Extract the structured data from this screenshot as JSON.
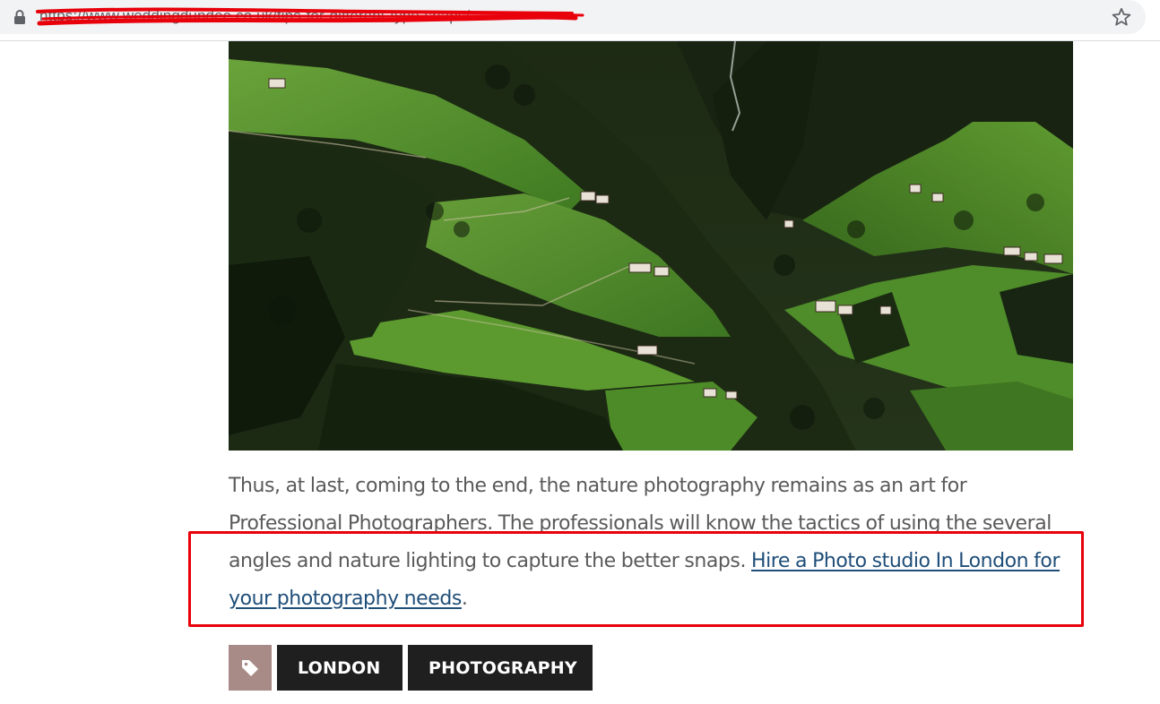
{
  "browser": {
    "url": "https://www.weddingdundee.co.uk/tips-for-different-type-snaps/",
    "bookmark_icon": "star-icon",
    "lock_icon": "lock-icon",
    "redaction_color": "#e8000b"
  },
  "article": {
    "image_alt": "Mountain valley with green meadows, forests and farmhouses",
    "paragraph_text": "Thus, at last, coming to the end, the nature photography remains as an art for Professional Photographers. The professionals will know the tactics of using the several angles and nature lighting to capture the better snaps. ",
    "link_text": "Hire a Photo studio In London for your photography needs",
    "trailing_text": ".",
    "link_color": "#1f4e79",
    "highlight_color": "#e8000b"
  },
  "tags": {
    "icon": "tag-icon",
    "items": [
      "LONDON",
      "PHOTOGRAPHY"
    ]
  }
}
